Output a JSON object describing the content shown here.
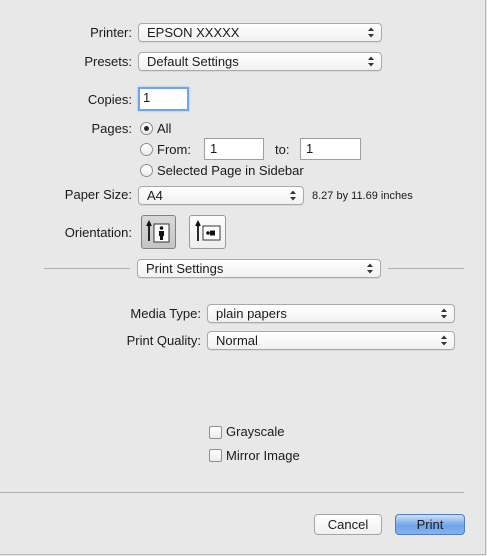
{
  "printer": {
    "label": "Printer:",
    "value": "EPSON XXXXX"
  },
  "presets": {
    "label": "Presets:",
    "value": "Default Settings"
  },
  "copies": {
    "label": "Copies:",
    "value": "1"
  },
  "pages": {
    "label": "Pages:",
    "all_label": "All",
    "from_label": "From:",
    "from_value": "1",
    "to_label": "to:",
    "to_value": "1",
    "selected_label": "Selected Page in Sidebar",
    "selected_option": "all"
  },
  "paper_size": {
    "label": "Paper Size:",
    "value": "A4",
    "dimensions": "8.27 by 11.69 inches"
  },
  "orientation": {
    "label": "Orientation:",
    "selected": "portrait"
  },
  "section_popup": {
    "value": "Print Settings"
  },
  "media_type": {
    "label": "Media Type:",
    "value": "plain papers"
  },
  "print_quality": {
    "label": "Print Quality:",
    "value": "Normal"
  },
  "grayscale": {
    "label": "Grayscale",
    "checked": false
  },
  "mirror_image": {
    "label": "Mirror Image",
    "checked": false
  },
  "buttons": {
    "cancel": "Cancel",
    "print": "Print"
  },
  "colors": {
    "accent": "#6ea4ea",
    "focus_ring": "#6ea5e8"
  }
}
